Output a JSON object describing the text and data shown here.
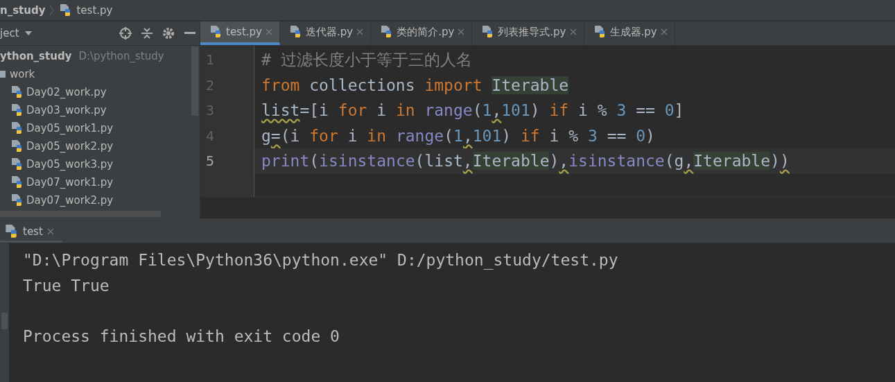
{
  "breadcrumbs": [
    {
      "label": "n_study",
      "kind": "folder"
    },
    {
      "label": "test.py",
      "kind": "file"
    }
  ],
  "project_panel": {
    "title": "ject",
    "tree": [
      {
        "label": "ython_study",
        "path": "D:\\python_study",
        "kind": "root",
        "children": [
          {
            "label": "work",
            "kind": "folder",
            "children": [
              {
                "label": "Day02_work.py",
                "kind": "file"
              },
              {
                "label": "Day03_work.py",
                "kind": "file"
              },
              {
                "label": "Day05_work1.py",
                "kind": "file"
              },
              {
                "label": "Day05_work2.py",
                "kind": "file"
              },
              {
                "label": "Day05_work3.py",
                "kind": "file"
              },
              {
                "label": "Day07_work1.py",
                "kind": "file"
              },
              {
                "label": "Day07_work2.py",
                "kind": "file"
              }
            ]
          }
        ]
      }
    ]
  },
  "editor_tabs": [
    {
      "label": "test.py",
      "selected": true
    },
    {
      "label": "迭代器.py",
      "selected": false
    },
    {
      "label": "类的简介.py",
      "selected": false
    },
    {
      "label": "列表推导式.py",
      "selected": false
    },
    {
      "label": "生成器.py",
      "selected": false
    }
  ],
  "code_lines": [
    {
      "number": "1",
      "current": false,
      "tokens": [
        {
          "text": "# 过滤长度小于等于三的人名",
          "kind": "comment"
        }
      ]
    },
    {
      "number": "2",
      "current": false,
      "tokens": [
        {
          "text": "from",
          "kind": "keyword"
        },
        {
          "text": " collections ",
          "kind": "plain"
        },
        {
          "text": "import ",
          "kind": "keyword"
        },
        {
          "text": "Iterable",
          "kind": "ref"
        }
      ]
    },
    {
      "number": "3",
      "current": false,
      "tokens": [
        {
          "text": "list",
          "kind": "warn"
        },
        {
          "text": "=[i ",
          "kind": "plain"
        },
        {
          "text": "for",
          "kind": "keyword"
        },
        {
          "text": " i ",
          "kind": "plain"
        },
        {
          "text": "in",
          "kind": "keyword"
        },
        {
          "text": " range",
          "kind": "builtin"
        },
        {
          "text": "(",
          "kind": "plain"
        },
        {
          "text": "1",
          "kind": "number"
        },
        {
          "text": ",",
          "kind": "warn"
        },
        {
          "text": "101",
          "kind": "number"
        },
        {
          "text": ") ",
          "kind": "plain"
        },
        {
          "text": "if",
          "kind": "keyword"
        },
        {
          "text": " i % ",
          "kind": "plain"
        },
        {
          "text": "3",
          "kind": "number"
        },
        {
          "text": " == ",
          "kind": "plain"
        },
        {
          "text": "0",
          "kind": "number"
        },
        {
          "text": "]",
          "kind": "plain"
        }
      ]
    },
    {
      "number": "4",
      "current": false,
      "tokens": [
        {
          "text": "g",
          "kind": "plain"
        },
        {
          "text": "=",
          "kind": "warn"
        },
        {
          "text": "(i ",
          "kind": "plain"
        },
        {
          "text": "for",
          "kind": "keyword"
        },
        {
          "text": " i ",
          "kind": "plain"
        },
        {
          "text": "in",
          "kind": "keyword"
        },
        {
          "text": " range",
          "kind": "builtin"
        },
        {
          "text": "(",
          "kind": "plain"
        },
        {
          "text": "1",
          "kind": "number"
        },
        {
          "text": ",",
          "kind": "warn"
        },
        {
          "text": "101",
          "kind": "number"
        },
        {
          "text": ") ",
          "kind": "plain"
        },
        {
          "text": "if",
          "kind": "keyword"
        },
        {
          "text": " i % ",
          "kind": "plain"
        },
        {
          "text": "3",
          "kind": "number"
        },
        {
          "text": " == ",
          "kind": "plain"
        },
        {
          "text": "0",
          "kind": "number"
        },
        {
          "text": ")",
          "kind": "plain"
        }
      ]
    },
    {
      "number": "5",
      "current": true,
      "tokens": [
        {
          "text": "print",
          "kind": "builtin"
        },
        {
          "text": "(",
          "kind": "plain"
        },
        {
          "text": "isinstance",
          "kind": "builtin"
        },
        {
          "text": "(list",
          "kind": "plain"
        },
        {
          "text": ",",
          "kind": "warn"
        },
        {
          "text": "Iterable",
          "kind": "ref"
        },
        {
          "text": ")",
          "kind": "plain"
        },
        {
          "text": ",",
          "kind": "warn"
        },
        {
          "text": "isinstance",
          "kind": "builtin"
        },
        {
          "text": "(g",
          "kind": "plain"
        },
        {
          "text": ",",
          "kind": "warn"
        },
        {
          "text": "Iterable",
          "kind": "ref"
        },
        {
          "text": ")",
          "kind": "plain"
        },
        {
          "text": ")",
          "kind": "warn"
        }
      ]
    }
  ],
  "run_panel": {
    "tab": "test",
    "output": [
      {
        "text": "\"D:\\Program Files\\Python36\\python.exe\" D:/python_study/test.py",
        "blank_before": false
      },
      {
        "text": "True True",
        "blank_before": false
      },
      {
        "text": "Process finished with exit code 0",
        "blank_before": true
      }
    ]
  }
}
